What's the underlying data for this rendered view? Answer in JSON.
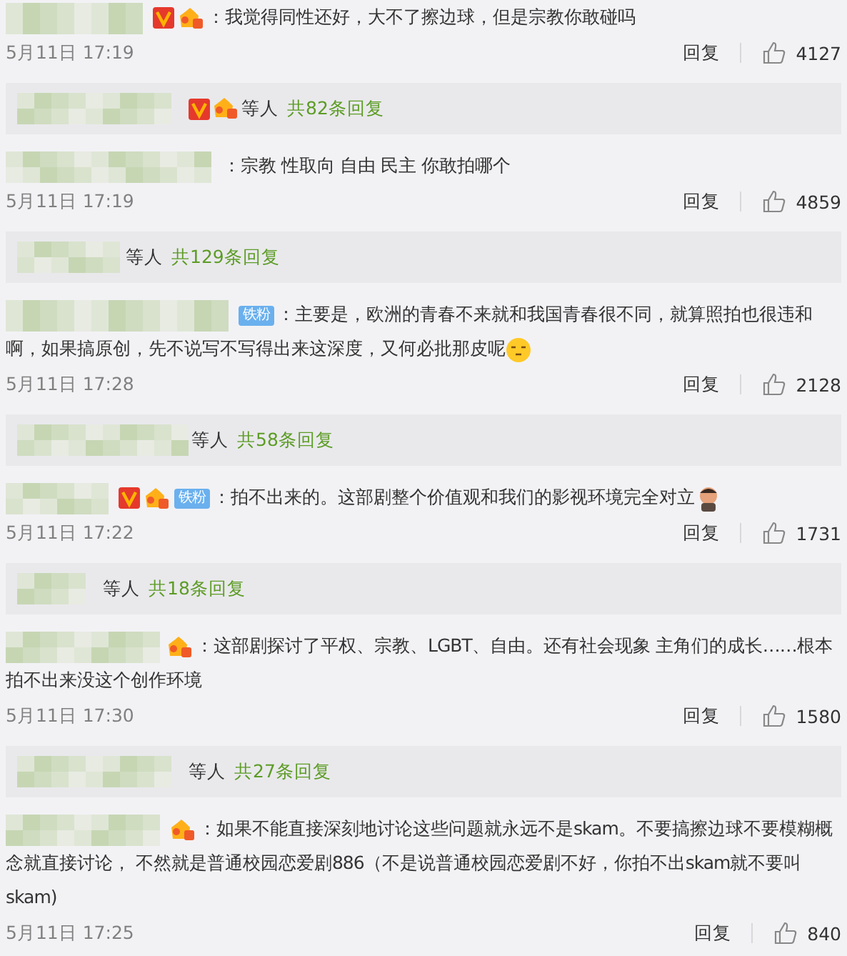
{
  "feed": [
    {
      "kind": "comment",
      "badges": [
        {
          "kind": "verified"
        },
        {
          "kind": "crown"
        }
      ],
      "text": "：我觉得同性还好，大不了擦边球，但是宗教你敢碰吗",
      "time": "5月11日 17:19",
      "reply": "回复",
      "likes": "4127"
    },
    {
      "kind": "replies",
      "badges": [
        {
          "kind": "verified"
        },
        {
          "kind": "crown"
        }
      ],
      "others": "等人",
      "count": "共82条回复"
    },
    {
      "kind": "comment",
      "text": "：宗教 性取向 自由 民主 你敢拍哪个",
      "time": "5月11日 17:19",
      "reply": "回复",
      "likes": "4859"
    },
    {
      "kind": "replies",
      "others": "等人",
      "count": "共129条回复"
    },
    {
      "kind": "comment",
      "badges": [
        {
          "kind": "fan",
          "label": "铁粉"
        }
      ],
      "text": "：主要是，欧洲的青春不来就和我国青春很不同，就算照拍也很违和啊，如果搞原创，先不说写不写得出来这深度，又何必批那皮呢",
      "trailing": [
        {
          "kind": "smiley"
        }
      ],
      "time": "5月11日 17:28",
      "reply": "回复",
      "likes": "2128"
    },
    {
      "kind": "replies",
      "others": "等人",
      "count": "共58条回复"
    },
    {
      "kind": "comment",
      "badges": [
        {
          "kind": "verified"
        },
        {
          "kind": "crown"
        },
        {
          "kind": "fan",
          "label": "铁粉"
        }
      ],
      "text": "：拍不出来的。这部剧整个价值观和我们的影视环境完全对立",
      "trailing": [
        {
          "kind": "figure"
        }
      ],
      "time": "5月11日 17:22",
      "reply": "回复",
      "likes": "1731"
    },
    {
      "kind": "replies",
      "others": "等人",
      "count": "共18条回复"
    },
    {
      "kind": "comment",
      "badges": [
        {
          "kind": "crown"
        }
      ],
      "text": "：这部剧探讨了平权、宗教、LGBT、自由。还有社会现象 主角们的成长……根本拍不出来没这个创作环境",
      "time": "5月11日 17:30",
      "reply": "回复",
      "likes": "1580"
    },
    {
      "kind": "replies",
      "others": "等人",
      "count": "共27条回复"
    },
    {
      "kind": "comment",
      "badges": [
        {
          "kind": "crown"
        }
      ],
      "text": "：如果不能直接深刻地讨论这些问题就永远不是skam。不要搞擦边球不要模糊概念就直接讨论， 不然就是普通校园恋爱剧886（不是说普通校园恋爱剧不好，你拍不出skam就不要叫skam)",
      "time": "5月11日 17:25",
      "reply": "回复",
      "likes": "840"
    }
  ]
}
